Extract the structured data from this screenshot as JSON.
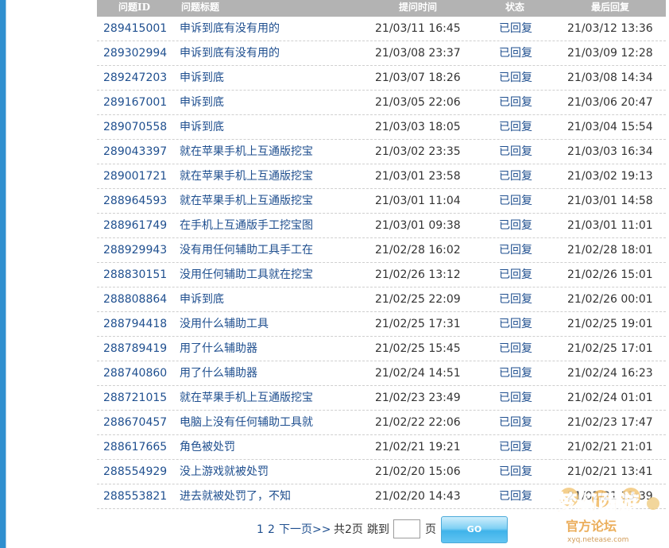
{
  "table": {
    "headers": {
      "id": "问题ID",
      "title": "问题标题",
      "time": "提问时间",
      "status": "状态",
      "last_reply": "最后回复"
    },
    "rows": [
      {
        "id": "289415001",
        "title": "申诉到底有没有用的",
        "time": "21/03/11 16:45",
        "status": "已回复",
        "last_reply": "21/03/12 13:36"
      },
      {
        "id": "289302994",
        "title": "申诉到底有没有用的",
        "time": "21/03/08 23:37",
        "status": "已回复",
        "last_reply": "21/03/09 12:28"
      },
      {
        "id": "289247203",
        "title": "申诉到底",
        "time": "21/03/07 18:26",
        "status": "已回复",
        "last_reply": "21/03/08 14:34"
      },
      {
        "id": "289167001",
        "title": "申诉到底",
        "time": "21/03/05 22:06",
        "status": "已回复",
        "last_reply": "21/03/06 20:47"
      },
      {
        "id": "289070558",
        "title": "申诉到底",
        "time": "21/03/03 18:05",
        "status": "已回复",
        "last_reply": "21/03/04 15:54"
      },
      {
        "id": "289043397",
        "title": "就在苹果手机上互通版挖宝",
        "time": "21/03/02 23:35",
        "status": "已回复",
        "last_reply": "21/03/03 16:34"
      },
      {
        "id": "289001721",
        "title": "就在苹果手机上互通版挖宝",
        "time": "21/03/01 23:58",
        "status": "已回复",
        "last_reply": "21/03/02 19:13"
      },
      {
        "id": "288964593",
        "title": "就在苹果手机上互通版挖宝",
        "time": "21/03/01 11:04",
        "status": "已回复",
        "last_reply": "21/03/01 14:58"
      },
      {
        "id": "288961749",
        "title": "在手机上互通版手工挖宝图",
        "time": "21/03/01 09:38",
        "status": "已回复",
        "last_reply": "21/03/01 11:01"
      },
      {
        "id": "288929943",
        "title": "没有用任何辅助工具手工在",
        "time": "21/02/28 16:02",
        "status": "已回复",
        "last_reply": "21/02/28 18:01"
      },
      {
        "id": "288830151",
        "title": "没用任何辅助工具就在挖宝",
        "time": "21/02/26 13:12",
        "status": "已回复",
        "last_reply": "21/02/26 15:01"
      },
      {
        "id": "288808864",
        "title": "申诉到底",
        "time": "21/02/25 22:09",
        "status": "已回复",
        "last_reply": "21/02/26 00:01"
      },
      {
        "id": "288794418",
        "title": "没用什么辅助工具",
        "time": "21/02/25 17:31",
        "status": "已回复",
        "last_reply": "21/02/25 19:01"
      },
      {
        "id": "288789419",
        "title": "用了什么辅助器",
        "time": "21/02/25 15:45",
        "status": "已回复",
        "last_reply": "21/02/25 17:01"
      },
      {
        "id": "288740860",
        "title": "用了什么辅助器",
        "time": "21/02/24 14:51",
        "status": "已回复",
        "last_reply": "21/02/24 16:23"
      },
      {
        "id": "288721015",
        "title": "就在苹果手机上互通版挖宝",
        "time": "21/02/23 23:49",
        "status": "已回复",
        "last_reply": "21/02/24 01:01"
      },
      {
        "id": "288670457",
        "title": "电脑上没有任何辅助工具就",
        "time": "21/02/22 22:06",
        "status": "已回复",
        "last_reply": "21/02/23 17:47"
      },
      {
        "id": "288617665",
        "title": "角色被处罚",
        "time": "21/02/21 19:21",
        "status": "已回复",
        "last_reply": "21/02/21 21:01"
      },
      {
        "id": "288554929",
        "title": "没上游戏就被处罚",
        "time": "21/02/20 15:06",
        "status": "已回复",
        "last_reply": "21/02/21 13:41"
      },
      {
        "id": "288553821",
        "title": "进去就被处罚了，不知",
        "time": "21/02/20 14:43",
        "status": "已回复",
        "last_reply": "21/02/21 13:39"
      }
    ]
  },
  "pager": {
    "page_1": "1",
    "page_2": "2",
    "next": "下一页>>",
    "total": "共2页",
    "jump_label": "跳到",
    "page_unit": "页",
    "input_value": "",
    "go_label": "GO"
  },
  "watermark": {
    "text_main": "梦幻西游",
    "text_sub": "官方论坛",
    "text_url": "xyq.netease.com"
  },
  "colors": {
    "sidebar": "#2f8fcf",
    "header_bg": "#b3b3b3",
    "link": "#1f4f8f",
    "go_button": "#3fb3ea"
  }
}
